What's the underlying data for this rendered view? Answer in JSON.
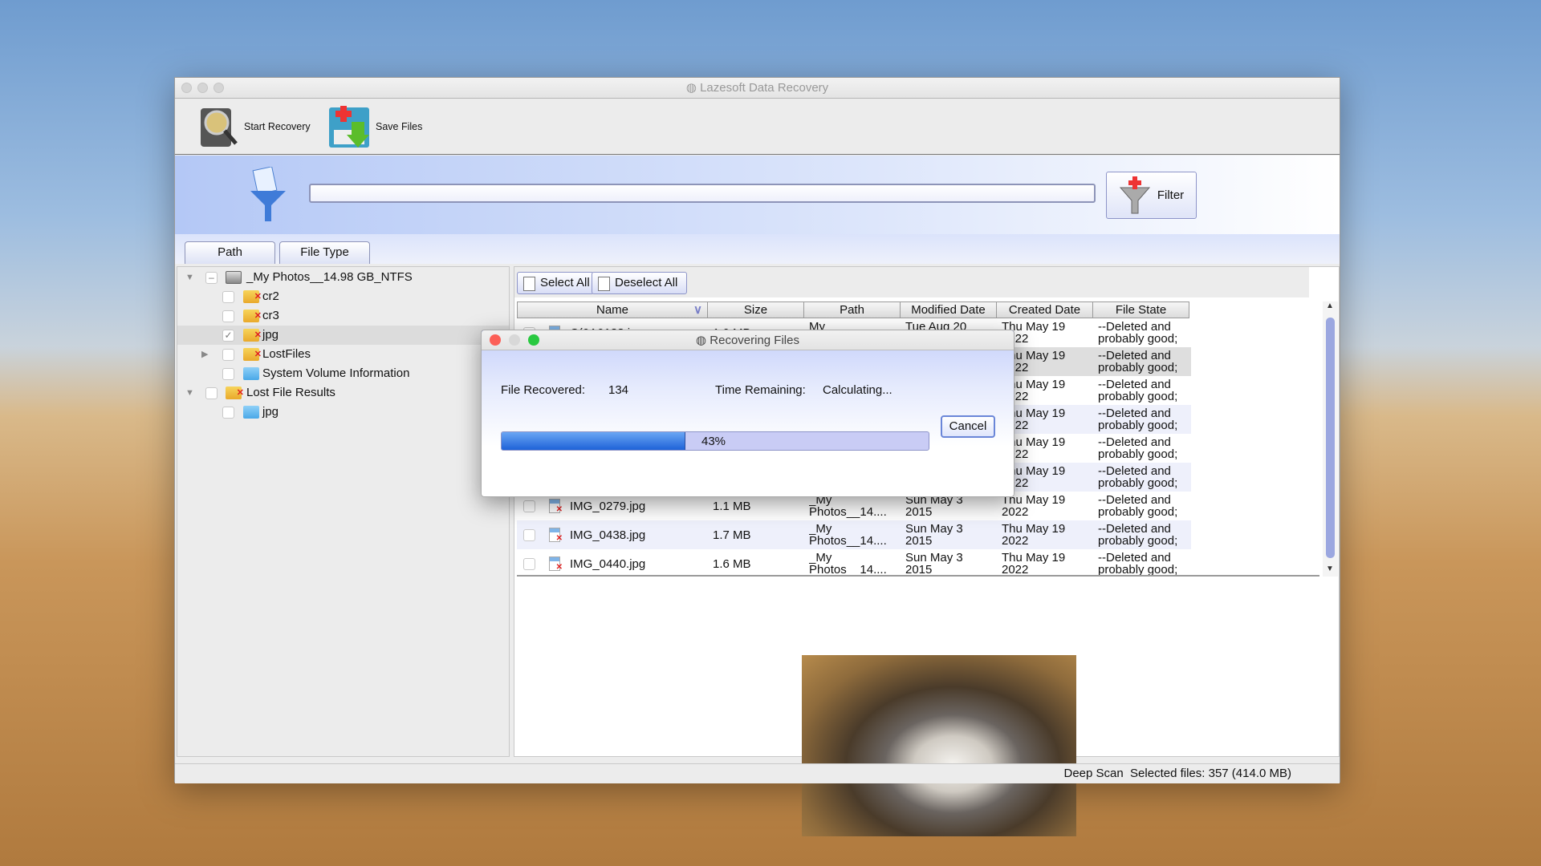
{
  "window": {
    "title": "Lazesoft Data Recovery"
  },
  "toolbar": {
    "start_recovery": "Start Recovery",
    "save_files": "Save Files"
  },
  "filter": {
    "input_value": "",
    "button_label": "Filter"
  },
  "tabs": [
    {
      "label": "Path",
      "active": true
    },
    {
      "label": "File Type",
      "active": false
    }
  ],
  "tree": [
    {
      "label": "_My Photos__14.98 GB_NTFS",
      "level": 0,
      "expanded": true,
      "icon": "drive-icon",
      "check": "partial"
    },
    {
      "label": "cr2",
      "level": 1,
      "icon": "folder-deleted-icon",
      "check": "off"
    },
    {
      "label": "cr3",
      "level": 1,
      "icon": "folder-deleted-icon",
      "check": "off"
    },
    {
      "label": "jpg",
      "level": 1,
      "icon": "folder-deleted-icon",
      "check": "on",
      "selected": true
    },
    {
      "label": "LostFiles",
      "level": 1,
      "collapsed": true,
      "icon": "folder-deleted-icon",
      "check": "off"
    },
    {
      "label": "System Volume Information",
      "level": 1,
      "icon": "folder-icon",
      "check": "off"
    },
    {
      "label": "Lost File Results",
      "level": 0,
      "expanded": true,
      "icon": "folder-deleted-icon",
      "check": "off"
    },
    {
      "label": "jpg",
      "level": 1,
      "icon": "folder-icon",
      "check": "off"
    }
  ],
  "list": {
    "select_all": "Select All",
    "deselect_all": "Deselect All",
    "columns": [
      "Name",
      "Size",
      "Path",
      "Modified Date",
      "Created Date",
      "File State"
    ],
    "rows": [
      {
        "name": "C(0A0138.j...",
        "size": "1.0 MB",
        "path": "My",
        "modified": "Tue Aug 20",
        "created": "Thu May 19\n2022",
        "state": "--Deleted and\nprobably good;"
      },
      {
        "name": "",
        "size": "",
        "path": "",
        "modified": "",
        "created": "Thu May 19\n2022",
        "state": "--Deleted and\nprobably good;"
      },
      {
        "name": "",
        "size": "",
        "path": "",
        "modified": "",
        "created": "Thu May 19\n2022",
        "state": "--Deleted and\nprobably good;"
      },
      {
        "name": "",
        "size": "",
        "path": "",
        "modified": "",
        "created": "Thu May 19\n2022",
        "state": "--Deleted and\nprobably good;"
      },
      {
        "name": "",
        "size": "",
        "path": "",
        "modified": "",
        "created": "Thu May 19\n2022",
        "state": "--Deleted and\nprobably good;"
      },
      {
        "name": "",
        "size": "",
        "path": "",
        "modified": "",
        "created": "Thu May 19\n2022",
        "state": "--Deleted and\nprobably good;"
      },
      {
        "name": "IMG_0279.jpg",
        "size": "1.1 MB",
        "path": "_My\nPhotos__14....",
        "modified": "Sun May 3\n2015",
        "created": "Thu May 19\n2022",
        "state": "--Deleted and\nprobably good;"
      },
      {
        "name": "IMG_0438.jpg",
        "size": "1.7 MB",
        "path": "_My\nPhotos__14....",
        "modified": "Sun May 3\n2015",
        "created": "Thu May 19\n2022",
        "state": "--Deleted and\nprobably good;"
      },
      {
        "name": "IMG_0440.jpg",
        "size": "1.6 MB",
        "path": "_My\nPhotos__14....",
        "modified": "Sun May 3\n2015",
        "created": "Thu May 19\n2022",
        "state": "--Deleted and\nprobably good;"
      }
    ]
  },
  "status": {
    "mode": "Deep Scan",
    "selected": "Selected files: 357 (414.0 MB)"
  },
  "dialog": {
    "title": "Recovering Files",
    "recovered_label": "File Recovered:",
    "recovered_value": "134",
    "remaining_label": "Time Remaining:",
    "remaining_value": "Calculating...",
    "progress_percent": 43,
    "progress_text": "43%",
    "cancel_label": "Cancel"
  },
  "colors": {
    "accent": "#1e62d8",
    "close": "#fc5f57",
    "minimize": "#d8d8d8",
    "zoom": "#29c940"
  }
}
